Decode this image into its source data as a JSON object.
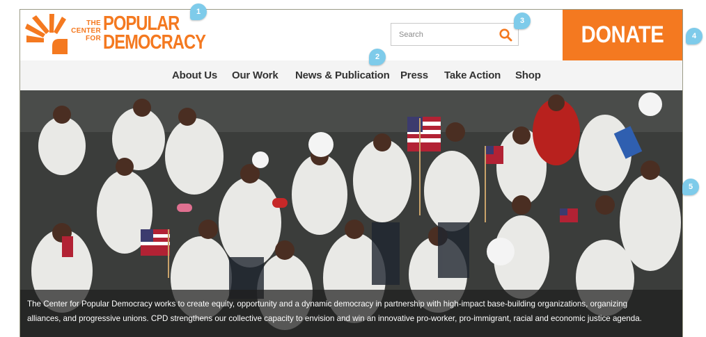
{
  "logo": {
    "small_lines": [
      "THE",
      "CENTER",
      "FOR"
    ],
    "big_lines": [
      "POPULAR",
      "DEMOCRACY"
    ],
    "color": "#f47920"
  },
  "search": {
    "placeholder": "Search",
    "icon": "search-icon"
  },
  "donate": {
    "label": "DONATE",
    "color": "#f47920"
  },
  "nav": {
    "items": [
      {
        "label": "About Us"
      },
      {
        "label": "Our Work"
      },
      {
        "label": "News & Publication"
      },
      {
        "label": "Press"
      },
      {
        "label": "Take Action"
      },
      {
        "label": "Shop"
      }
    ]
  },
  "hero": {
    "caption_line1": "The Center for Popular Democracy works to create equity, opportunity and a dynamic democracy in partnership with high-impact base-building organizations, organizing",
    "caption_line2": "alliances, and progressive unions. CPD strengthens our collective capacity to envision and win an innovative pro-worker, pro-immigrant, racial and economic justice agenda."
  },
  "markers": [
    "1",
    "2",
    "3",
    "4",
    "5"
  ],
  "colors": {
    "marker": "#7ecbea",
    "nav_bg": "#f4f4f4"
  }
}
